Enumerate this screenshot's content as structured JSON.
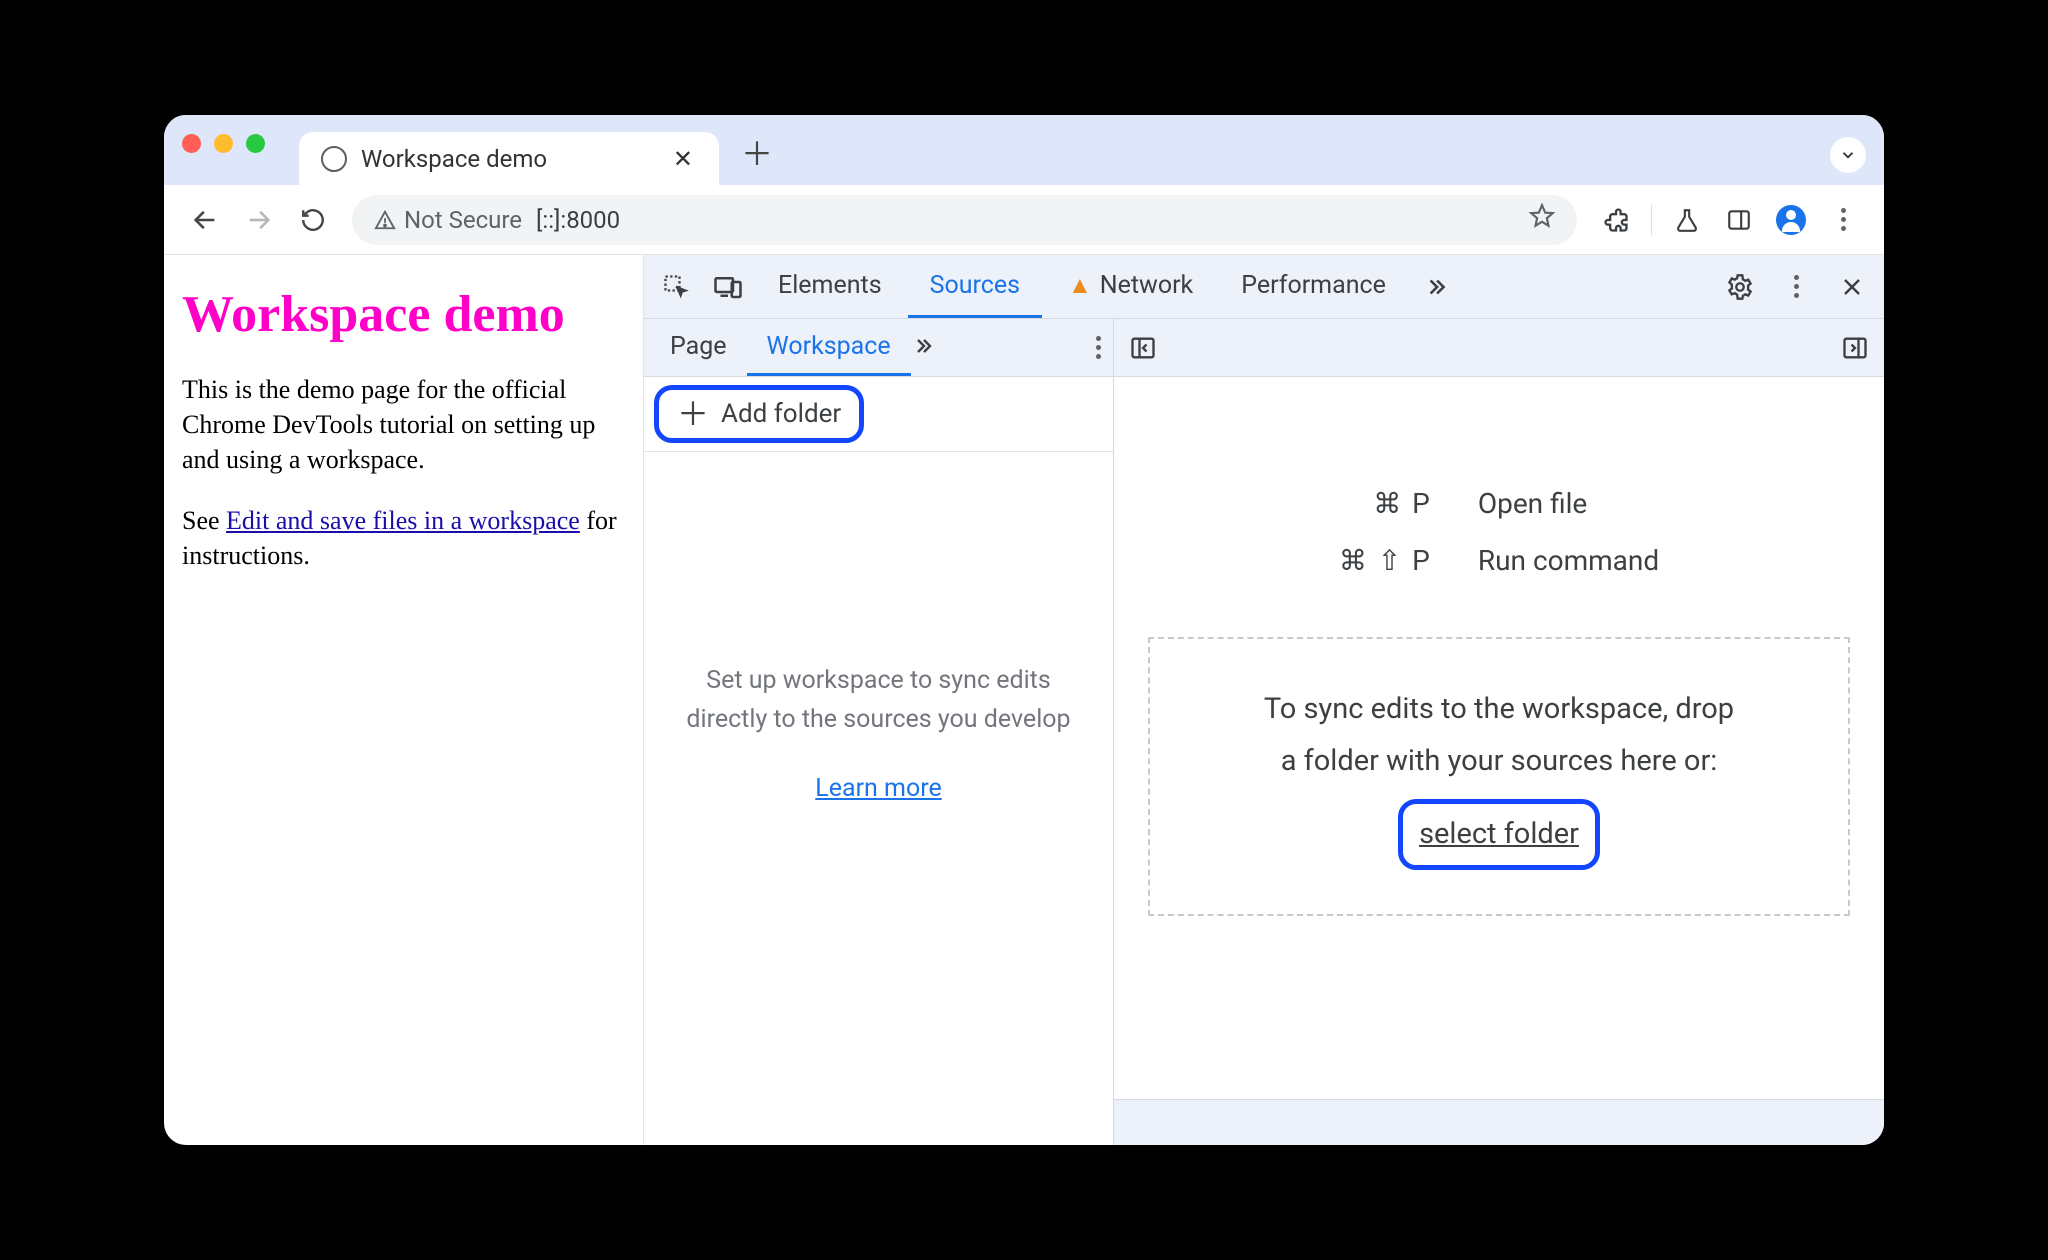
{
  "tab": {
    "title": "Workspace demo"
  },
  "addressbar": {
    "security_label": "Not Secure",
    "url": "[::]:8000"
  },
  "page": {
    "heading": "Workspace demo",
    "para1": "This is the demo page for the official Chrome DevTools tutorial on setting up and using a workspace.",
    "para2_pre": "See ",
    "para2_link": "Edit and save files in a workspace",
    "para2_post": " for instructions."
  },
  "devtools": {
    "tabs": {
      "elements": "Elements",
      "sources": "Sources",
      "network": "Network",
      "performance": "Performance"
    },
    "sources": {
      "subtabs": {
        "page": "Page",
        "workspace": "Workspace"
      },
      "add_folder": "Add folder",
      "workspace_hint": "Set up workspace to sync edits directly to the sources you develop",
      "learn_more": "Learn more"
    },
    "editor": {
      "shortcut_open_file_keys": "⌘  P",
      "shortcut_open_file_label": "Open file",
      "shortcut_run_cmd_keys": "⌘  ⇧  P",
      "shortcut_run_cmd_label": "Run command",
      "drop_text_l1": "To sync edits to the workspace, drop",
      "drop_text_l2": "a folder with your sources here or:",
      "select_folder": "select folder"
    }
  }
}
